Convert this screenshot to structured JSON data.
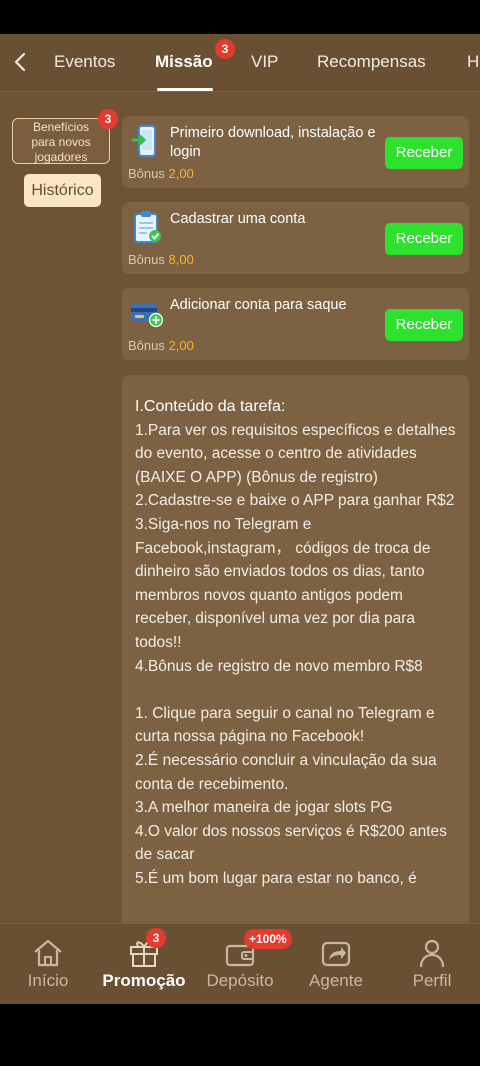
{
  "tabs": {
    "items": [
      "Eventos",
      "Missão",
      "VIP",
      "Recompensas",
      "H"
    ],
    "active": "Missão",
    "mission_badge": "3"
  },
  "sidebar": {
    "new_players_label_line1": "Benefícios",
    "new_players_label_line2": "para novos",
    "new_players_label_line3": "jogadores",
    "new_players_badge": "3",
    "history_label": "Histórico"
  },
  "tasks": [
    {
      "title": "Primeiro download, instalação e login",
      "bonus_label": "Bônus",
      "bonus_value": "2,00",
      "button": "Receber",
      "icon": "phone-download-icon"
    },
    {
      "title": "Cadastrar uma conta",
      "bonus_label": "Bônus",
      "bonus_value": "8,00",
      "button": "Receber",
      "icon": "clipboard-check-icon"
    },
    {
      "title": "Adicionar conta para saque",
      "bonus_label": "Bônus",
      "bonus_value": "2,00",
      "button": "Receber",
      "icon": "card-add-icon"
    }
  ],
  "content": {
    "lines": [
      "I.Conteúdo da tarefa:",
      "1.Para ver os requisitos específicos e detalhes do evento, acesse o centro de atividades (BAIXE O APP) (Bônus de registro)",
      "2.Cadastre-se e baixe o APP para ganhar R$2",
      "3.Siga-nos no Telegram e Facebook,instagram， códigos de troca de dinheiro são enviados todos os dias, tanto membros novos quanto antigos podem receber, disponível uma vez por dia para todos!!",
      "4.Bônus de registro de novo membro R$8",
      "",
      "1. Clique para seguir o canal no Telegram e curta nossa página no Facebook!",
      "2.É necessário concluir a vinculação da sua conta de recebimento.",
      "3.A melhor maneira de jogar slots PG",
      "4.O valor dos nossos serviços é R$200 antes de sacar",
      "5.É um bom lugar para estar no banco, é"
    ]
  },
  "bottom_nav": {
    "items": [
      {
        "label": "Início",
        "icon": "home-icon"
      },
      {
        "label": "Promoção",
        "icon": "gift-icon",
        "badge": "3"
      },
      {
        "label": "Depósito",
        "icon": "wallet-icon",
        "badge": "+100%"
      },
      {
        "label": "Agente",
        "icon": "share-icon"
      },
      {
        "label": "Perfil",
        "icon": "user-icon"
      }
    ],
    "active": "Promoção"
  },
  "colors": {
    "background": "#6e5434",
    "card": "#7c6243",
    "accent_green": "#2fe12f",
    "bonus_gold": "#f7b62a",
    "badge_red": "#e43b2e"
  }
}
